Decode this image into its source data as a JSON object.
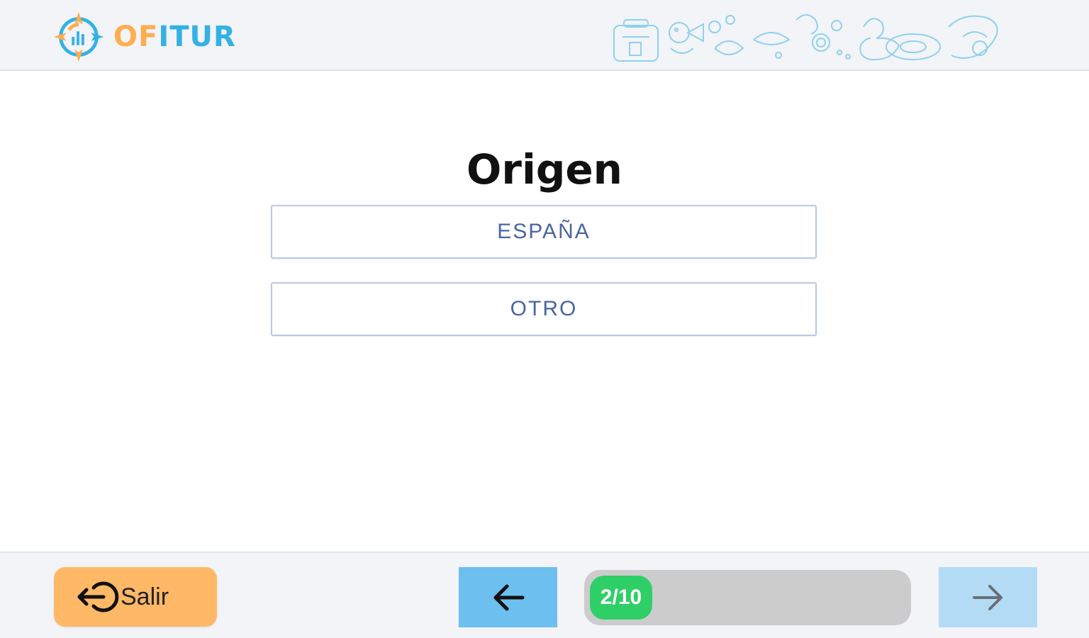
{
  "app": {
    "logo_text_orange": "OF",
    "logo_text_blue": "I",
    "logo_text_end": "TUR",
    "brand_orange": "#ffad4d",
    "brand_blue": "#34b1e4"
  },
  "question": {
    "title": "Origen",
    "options": [
      {
        "label": "ESPAÑA"
      },
      {
        "label": "OTRO"
      }
    ]
  },
  "footer": {
    "exit_label": "Salir",
    "exit_icon": "logout-icon",
    "back_icon": "arrow-left-icon",
    "next_icon": "arrow-right-icon",
    "progress_label": "2/10",
    "progress_current": 2,
    "progress_total": 10
  }
}
